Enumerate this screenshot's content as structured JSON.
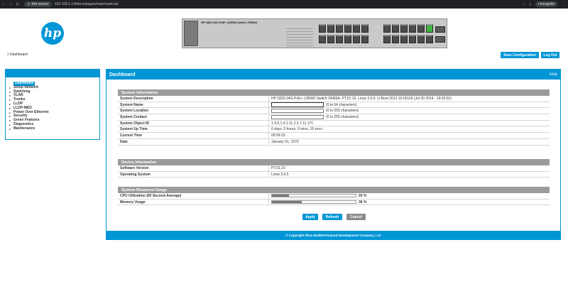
{
  "browser": {
    "security": "Not secure",
    "url": "192.168.1.1/htdocs/pages/main/main.lsp",
    "profile": "Incognito"
  },
  "header": {
    "logo_text": "hp",
    "switch_model": "HP 1820-24G-PoE+ (185W) Switch J9983A",
    "breadcrumb": "> Dashboard",
    "save_config": "Save Configuration",
    "logout": "Log Out"
  },
  "sidebar": {
    "items": [
      {
        "label": "Dashboard",
        "active": true
      },
      {
        "label": "Setup Network"
      },
      {
        "label": "Switching"
      },
      {
        "label": "VLAN"
      },
      {
        "label": "Trunks"
      },
      {
        "label": "LLDP"
      },
      {
        "label": "LLDP-MED"
      },
      {
        "label": "Power Over Ethernet"
      },
      {
        "label": "Security"
      },
      {
        "label": "Green Features"
      },
      {
        "label": "Diagnostics"
      },
      {
        "label": "Maintenance"
      }
    ]
  },
  "main": {
    "title": "Dashboard",
    "help": "Help",
    "system_info": {
      "title": "System Information",
      "description_label": "System Description",
      "description_value": "HP 1820-24G-PoE+ (185W) Switch J9983A, PT.01.10, Linux 3.6.5, U-Boot 2012.10-00116 (Jul 30 2014 - 10:52:01)",
      "name_label": "System Name",
      "name_hint": "(0 to 64 characters)",
      "location_label": "System Location",
      "location_hint": "(0 to 255 characters)",
      "contact_label": "System Contact",
      "contact_hint": "(0 to 255 characters)",
      "object_id_label": "System Object ID",
      "object_id_value": "1.3.6.1.4.1.11.2.3.7.11.171",
      "uptime_label": "System Up Time",
      "uptime_value": "0 days, 0 hours, 9 mins, 19 secs",
      "current_time_label": "Current Time",
      "current_time_value": "00:09:19",
      "date_label": "Date",
      "date_value": "January 01, 1970"
    },
    "device_info": {
      "title": "Device Information",
      "software_label": "Software Version",
      "software_value": "PT.01.10",
      "os_label": "Operating System",
      "os_value": "Linux 3.6.5"
    },
    "resource_usage": {
      "title": "System Resource Usage",
      "cpu_label": "CPU Utilization (60 Second Average)",
      "cpu_value": "20 %",
      "cpu_percent": 20,
      "mem_label": "Memory Usage",
      "mem_value": "36 %",
      "mem_percent": 36
    },
    "buttons": {
      "apply": "Apply",
      "refresh": "Refresh",
      "cancel": "Cancel"
    },
    "footer": "© Copyright 2014 Hewlett-Packard Development Company, L.P."
  },
  "colors": {
    "accent": "#0096d6",
    "section_header": "#9b9b9b"
  }
}
